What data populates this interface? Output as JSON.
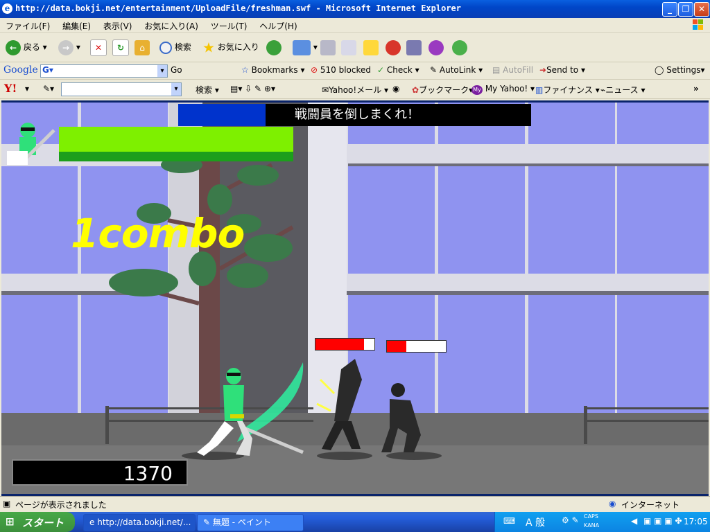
{
  "window": {
    "title": "http://data.bokji.net/entertainment/UploadFile/freshman.swf - Microsoft Internet Explorer",
    "minimize": "_",
    "maximize": "❐",
    "close": "✕"
  },
  "menu": [
    "ファイル(F)",
    "編集(E)",
    "表示(V)",
    "お気に入り(A)",
    "ツール(T)",
    "ヘルプ(H)"
  ],
  "toolbar": {
    "back": "戻る",
    "search": "検索",
    "favorites": "お気に入り"
  },
  "google_bar": {
    "logo": "Google",
    "go": "Go",
    "bookmarks": "Bookmarks",
    "blocked": "510 blocked",
    "check": "Check",
    "autolink": "AutoLink",
    "autofill": "AutoFill",
    "send_to": "Send to",
    "settings": "Settings"
  },
  "yahoo_bar": {
    "logo": "Y!",
    "search": "検索",
    "mail": "Yahoo!メール",
    "bookmark": "ブックマーク",
    "my_yahoo": "My Yahoo!",
    "finance": "ファイナンス",
    "news": "ニュース",
    "more": "»"
  },
  "game": {
    "mission": "戦闘員を倒しまくれ！",
    "combo": "1combo",
    "score": "1370",
    "player_hp": 1.0,
    "enemy1_hp": 0.82,
    "enemy2_hp": 0.33,
    "colors": {
      "hp_bar": "#7ef000",
      "enemy_hp": "#ff0000",
      "combo_text": "#ffff00",
      "ranger": "#2fe07a",
      "mission_box": "#0033cc"
    }
  },
  "status_bar": {
    "message": "ページが表示されました",
    "zone": "インターネット"
  },
  "taskbar": {
    "start": "スタート",
    "task1": "http://data.bokji.net/...",
    "task2": "無題 - ペイント",
    "ime": "A 般",
    "caps": "CAPS",
    "kana": "KANA",
    "clock": "17:05"
  }
}
